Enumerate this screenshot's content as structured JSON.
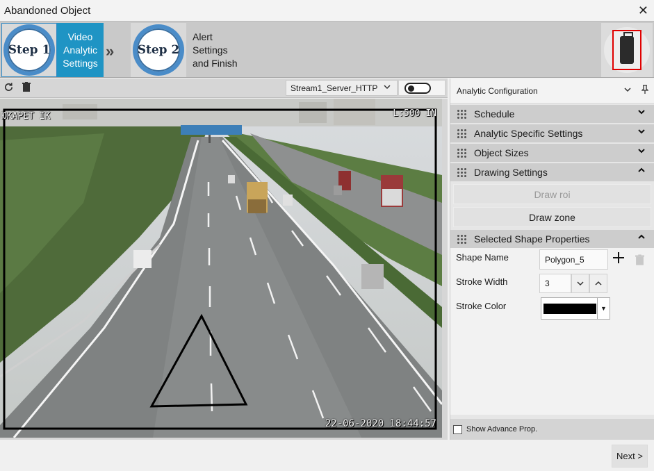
{
  "window": {
    "title": "Abandoned Object",
    "close_glyph": "✕"
  },
  "stepper": {
    "step1": {
      "badge": "Step 1",
      "label": "Video Analytic Settings"
    },
    "step2": {
      "badge": "Step 2",
      "label": "Alert Settings and Finish"
    },
    "separator_glyph": "»",
    "preview_icon": "suitcase-icon"
  },
  "video_toolbar": {
    "refresh_icon": "refresh-icon",
    "delete_icon": "trash-icon",
    "stream": "Stream1_Server_HTTP",
    "toggle_state": "off"
  },
  "video": {
    "camera_name": "ЮКАРЕТ ІК",
    "top_right_text": "L:500 IN",
    "timestamp": "22-06-2020 18:44:57",
    "zone_shape": "triangle"
  },
  "panel": {
    "title": "Analytic Configuration",
    "sections": [
      {
        "label": "Schedule",
        "expanded": false
      },
      {
        "label": "Analytic Specific Settings",
        "expanded": false
      },
      {
        "label": "Object Sizes",
        "expanded": false
      },
      {
        "label": "Drawing Settings",
        "expanded": true
      }
    ],
    "draw_roi_label": "Draw roi",
    "draw_zone_label": "Draw zone",
    "shape_section_label": "Selected Shape Properties",
    "shape_name_label": "Shape Name",
    "shape_name_value": "Polygon_5",
    "stroke_width_label": "Stroke Width",
    "stroke_width_value": "3",
    "stroke_color_label": "Stroke Color",
    "stroke_color_value": "#000000",
    "show_advance_label": "Show Advance Prop."
  },
  "footer": {
    "next_label": "Next >"
  }
}
